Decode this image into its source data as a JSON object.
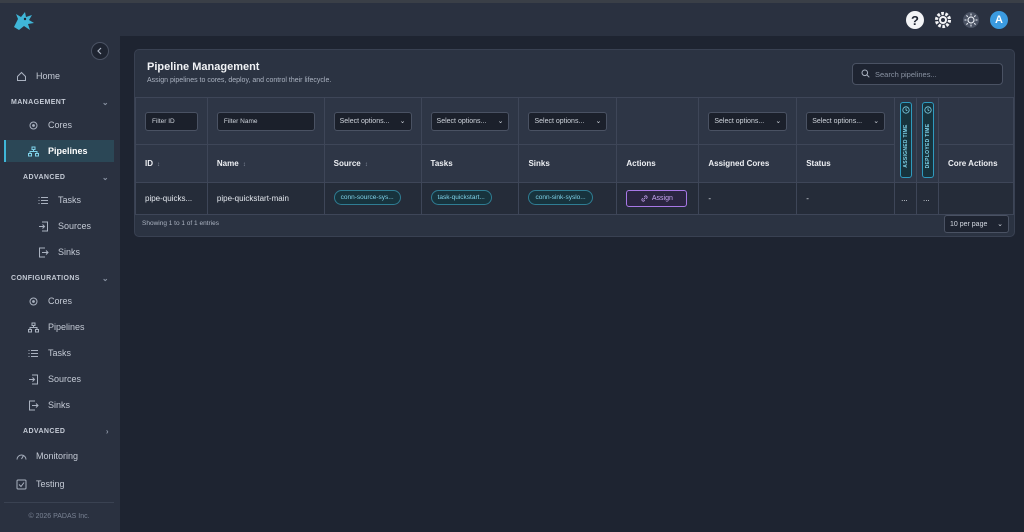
{
  "topbar": {
    "icons": [
      "help-icon",
      "gear-icon",
      "theme-icon"
    ],
    "avatar_letter": "A",
    "help_glyph": "?"
  },
  "sidebar": {
    "home": "Home",
    "management": {
      "label": "MANAGEMENT",
      "items": [
        "Cores",
        "Pipelines"
      ],
      "advanced": {
        "label": "ADVANCED",
        "items": [
          "Tasks",
          "Sources",
          "Sinks"
        ]
      }
    },
    "configurations": {
      "label": "CONFIGURATIONS",
      "items": [
        "Cores",
        "Pipelines",
        "Tasks",
        "Sources",
        "Sinks"
      ],
      "advanced_label": "ADVANCED"
    },
    "monitoring": "Monitoring",
    "testing": "Testing",
    "footer": "© 2026 PADAS Inc.",
    "active_item": "Pipelines"
  },
  "card": {
    "title": "Pipeline Management",
    "subtitle": "Assign pipelines to cores, deploy, and control their lifecycle.",
    "search_placeholder": "Search pipelines..."
  },
  "filters": {
    "id_placeholder": "Filter ID",
    "name_placeholder": "Filter Name",
    "select_placeholder": "Select options..."
  },
  "columns": {
    "id": "ID",
    "name": "Name",
    "source": "Source",
    "tasks": "Tasks",
    "sinks": "Sinks",
    "actions": "Actions",
    "assigned_cores": "Assigned Cores",
    "status": "Status",
    "assigned_time": "ASSIGNED TIME",
    "deployed_time": "DEPLOYED TIME",
    "core_actions": "Core Actions"
  },
  "rows": [
    {
      "id": "pipe-quicks...",
      "name": "pipe-quickstart-main",
      "source": "conn-source-sys...",
      "tasks": "task-quickstart...",
      "sinks": "conn-sink-syslo...",
      "action": "Assign",
      "assigned_cores": "-",
      "status": "-",
      "assigned_time": "...",
      "deployed_time": "..."
    }
  ],
  "footer": {
    "entries": "Showing 1 to 1 of 1 entries",
    "per_page": "10 per page"
  },
  "colors": {
    "accent": "#3fb6d8",
    "assign": "#a878e6",
    "background": "#1e2431",
    "panel": "#2b3342"
  }
}
